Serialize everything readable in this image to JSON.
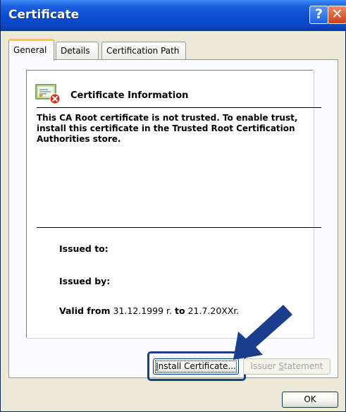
{
  "window": {
    "title": "Certificate"
  },
  "titlebar": {
    "help_glyph": "?",
    "close_glyph": "✕"
  },
  "tabs": [
    {
      "label": "General"
    },
    {
      "label": "Details"
    },
    {
      "label": "Certification Path"
    }
  ],
  "cert_info": {
    "icon": "certificate-error-icon",
    "heading": "Certificate Information",
    "warning": "This CA Root certificate is not trusted. To enable trust, install this certificate in the Trusted Root Certification Authorities store.",
    "issued_to_label": "Issued to:",
    "issued_by_label": "Issued by:",
    "valid_from_label": "Valid from",
    "valid_from_value": "31.12.1999 r.",
    "valid_to_label": "to",
    "valid_to_value": "21.7.20XXr."
  },
  "buttons": {
    "install_prefix": "I",
    "install_rest": "nstall Certificate...",
    "issuer_prefix": "Issuer ",
    "issuer_access": "S",
    "issuer_rest": "tatement",
    "ok": "OK"
  },
  "annotation": {
    "arrow_color": "#1a3e8c"
  },
  "colors": {
    "titlebar": "#0a4bd0",
    "dialog_bg": "#ece9d8",
    "active_tab_accent": "#ffc83c"
  }
}
